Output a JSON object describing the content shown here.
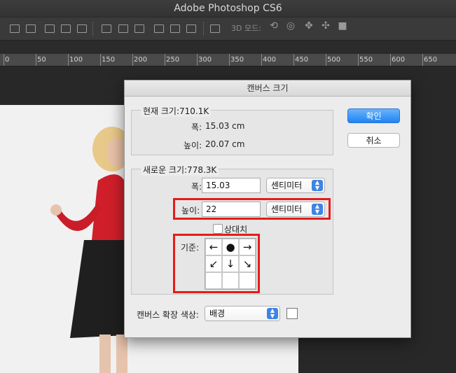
{
  "app": {
    "title": "Adobe Photoshop CS6"
  },
  "toolbar": {
    "mode3d_label": "3D 모드:"
  },
  "ruler": {
    "ticks": [
      "0",
      "50",
      "100",
      "150",
      "200",
      "250",
      "300",
      "350",
      "400",
      "450",
      "500",
      "550",
      "600",
      "650"
    ]
  },
  "dialog": {
    "title": "캔버스 크기",
    "current": {
      "legend": "현재 크기:710.1K",
      "width_label": "폭:",
      "width_value": "15.03 cm",
      "height_label": "높이:",
      "height_value": "20.07 cm"
    },
    "new": {
      "legend": "새로운 크기:778.3K",
      "width_label": "폭:",
      "width_value": "15.03",
      "width_unit": "센티미터",
      "height_label": "높이:",
      "height_value": "22",
      "height_unit": "센티미터",
      "relative_label": "상대치",
      "anchor_label": "기준:",
      "anchor_cells": [
        "←",
        "●",
        "→",
        "↙",
        "↓",
        "↘",
        "",
        "",
        ""
      ]
    },
    "extension_label": "캔버스 확장 색상:",
    "extension_value": "배경",
    "ok_label": "확인",
    "cancel_label": "취소"
  },
  "colors": {
    "accent": "#1f83f4",
    "highlight": "#e41c1c"
  }
}
